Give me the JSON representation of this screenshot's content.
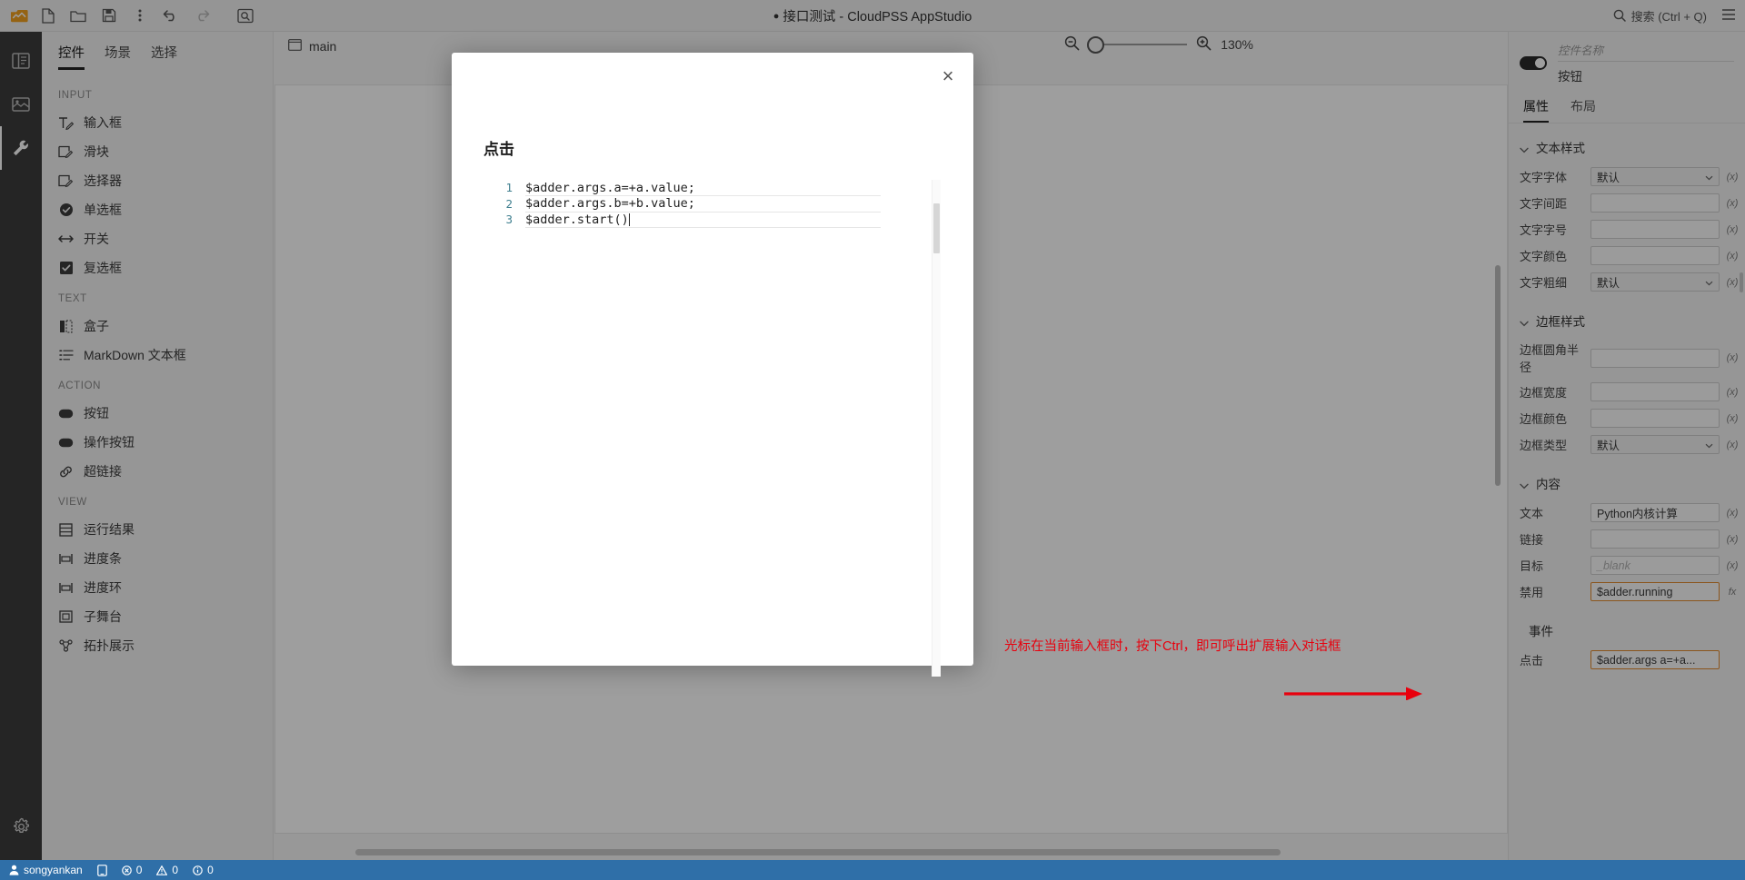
{
  "titlebar": {
    "title_dot": "●",
    "title": "接口测试 - CloudPSS AppStudio",
    "search_label": "搜索 (Ctrl + Q)",
    "buttons": [
      {
        "name": "logo",
        "label": "CloudPSS"
      },
      {
        "name": "new-file",
        "label": "新建"
      },
      {
        "name": "open-folder",
        "label": "打开"
      },
      {
        "name": "save",
        "label": "保存"
      },
      {
        "name": "more",
        "label": "更多"
      },
      {
        "name": "undo",
        "label": "撤销"
      },
      {
        "name": "redo",
        "label": "重做"
      },
      {
        "name": "preview",
        "label": "预览"
      }
    ]
  },
  "rail": {
    "items": [
      {
        "name": "project-icon",
        "label": "项目"
      },
      {
        "name": "resource-icon",
        "label": "资源"
      },
      {
        "name": "tools-icon",
        "label": "工具"
      }
    ],
    "settings": {
      "name": "settings-icon",
      "label": "设置"
    }
  },
  "left_panel": {
    "tabs": [
      {
        "label": "控件",
        "active": true
      },
      {
        "label": "场景",
        "active": false
      },
      {
        "label": "选择",
        "active": false
      }
    ],
    "groups": [
      {
        "title": "INPUT",
        "items": [
          {
            "label": "输入框",
            "icon": "textbox-icon"
          },
          {
            "label": "滑块",
            "icon": "slider-icon"
          },
          {
            "label": "选择器",
            "icon": "selector-icon"
          },
          {
            "label": "单选框",
            "icon": "radio-icon"
          },
          {
            "label": "开关",
            "icon": "switch-icon"
          },
          {
            "label": "复选框",
            "icon": "checkbox-icon"
          }
        ]
      },
      {
        "title": "TEXT",
        "items": [
          {
            "label": "盒子",
            "icon": "box-icon"
          },
          {
            "label": "MarkDown 文本框",
            "icon": "markdown-icon"
          }
        ]
      },
      {
        "title": "ACTION",
        "items": [
          {
            "label": "按钮",
            "icon": "button-icon"
          },
          {
            "label": "操作按钮",
            "icon": "action-button-icon"
          },
          {
            "label": "超链接",
            "icon": "link-icon"
          }
        ]
      },
      {
        "title": "VIEW",
        "items": [
          {
            "label": "运行结果",
            "icon": "result-icon"
          },
          {
            "label": "进度条",
            "icon": "progress-bar-icon"
          },
          {
            "label": "进度环",
            "icon": "progress-ring-icon"
          },
          {
            "label": "子舞台",
            "icon": "substage-icon"
          },
          {
            "label": "拓扑展示",
            "icon": "topology-icon"
          }
        ]
      }
    ]
  },
  "canvas": {
    "tab_label": "main",
    "zoom": {
      "level": "130%",
      "zoom_out": "缩小",
      "zoom_in": "放大"
    }
  },
  "right_panel": {
    "component_name_placeholder": "控件名称",
    "component_type": "按钮",
    "tabs": [
      {
        "label": "属性",
        "active": true
      },
      {
        "label": "布局",
        "active": false
      }
    ],
    "sections": [
      {
        "title": "文本样式",
        "rows": [
          {
            "label": "文字字体",
            "value": "默认",
            "kind": "select",
            "fx": "(x)"
          },
          {
            "label": "文字间距",
            "value": "",
            "kind": "text",
            "fx": "(x)"
          },
          {
            "label": "文字字号",
            "value": "",
            "kind": "text",
            "fx": "(x)"
          },
          {
            "label": "文字颜色",
            "value": "",
            "kind": "text",
            "fx": "(x)"
          },
          {
            "label": "文字粗细",
            "value": "默认",
            "kind": "select",
            "fx": "(x)"
          }
        ]
      },
      {
        "title": "边框样式",
        "rows": [
          {
            "label": "边框圆角半径",
            "value": "",
            "kind": "text",
            "fx": "(x)"
          },
          {
            "label": "边框宽度",
            "value": "",
            "kind": "text",
            "fx": "(x)"
          },
          {
            "label": "边框颜色",
            "value": "",
            "kind": "text",
            "fx": "(x)"
          },
          {
            "label": "边框类型",
            "value": "默认",
            "kind": "select",
            "fx": "(x)"
          }
        ]
      },
      {
        "title": "内容",
        "rows": [
          {
            "label": "文本",
            "value": "Python内核计算",
            "kind": "text",
            "fx": "(x)"
          },
          {
            "label": "链接",
            "value": "",
            "kind": "text",
            "fx": "(x)"
          },
          {
            "label": "目标",
            "value": "_blank",
            "kind": "placeholder",
            "fx": "(x)"
          },
          {
            "label": "禁用",
            "value": "$adder.running",
            "kind": "expr",
            "fx": "fx"
          }
        ]
      },
      {
        "title": "事件",
        "rows": [
          {
            "label": "点击",
            "value": "$adder.args a=+a...",
            "kind": "expr",
            "fx": ""
          }
        ]
      }
    ]
  },
  "modal": {
    "title": "点击",
    "close_label": "×",
    "code_lines": [
      {
        "no": "1",
        "text": "$adder.args.a=+a.value;"
      },
      {
        "no": "2",
        "text": "$adder.args.b=+b.value;"
      },
      {
        "no": "3",
        "text": "$adder.start()"
      }
    ]
  },
  "annotation": {
    "text": "光标在当前输入框时，按下Ctrl，即可呼出扩展输入对话框",
    "color": "#e8000d"
  },
  "statusbar": {
    "user": "songyankan",
    "user_icon": "user-icon",
    "device_icon": "device-icon",
    "errors": "0",
    "warnings": "0",
    "infos": "0"
  }
}
